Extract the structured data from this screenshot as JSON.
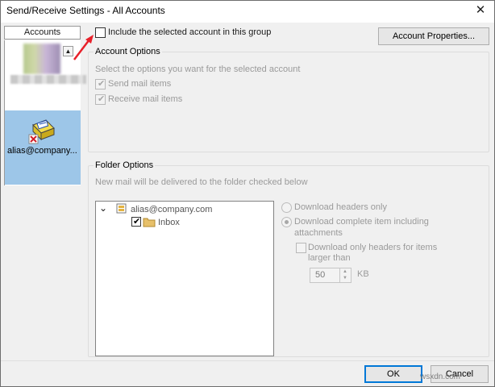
{
  "window": {
    "title": "Send/Receive Settings - All Accounts",
    "close_icon": "close-icon",
    "close_glyph": "✕"
  },
  "accounts": {
    "header": "Accounts",
    "selected_account": "alias@company...",
    "scroll_up_glyph": "▲"
  },
  "include_account": {
    "label": "Include the selected account in this group",
    "checked": false
  },
  "account_properties_button": "Account Properties...",
  "account_options": {
    "title": "Account Options",
    "description": "Select the options you want for the selected account",
    "send_mail": {
      "label": "Send mail items",
      "checked": true
    },
    "receive_mail": {
      "label": "Receive mail items",
      "checked": true
    }
  },
  "folder_options": {
    "title": "Folder Options",
    "description": "New mail will be delivered to the folder checked below",
    "tree": {
      "expand_glyph": "⌄",
      "root": "alias@company.com",
      "child": "Inbox",
      "child_checked": true
    },
    "download_headers_only": "Download headers only",
    "download_complete_line1": "Download complete item including",
    "download_complete_line2": "attachments",
    "download_large_line1": "Download only headers for items",
    "download_large_line2": "larger than",
    "size_value": "50",
    "size_unit": "KB"
  },
  "check_glyph": "✔",
  "buttons": {
    "ok": "OK",
    "cancel": "Cancel"
  },
  "watermark": "wsxdn.com",
  "colors": {
    "selection": "#9dc6e8",
    "annotation_arrow": "#e8202a",
    "default_button_border": "#0078d7"
  }
}
